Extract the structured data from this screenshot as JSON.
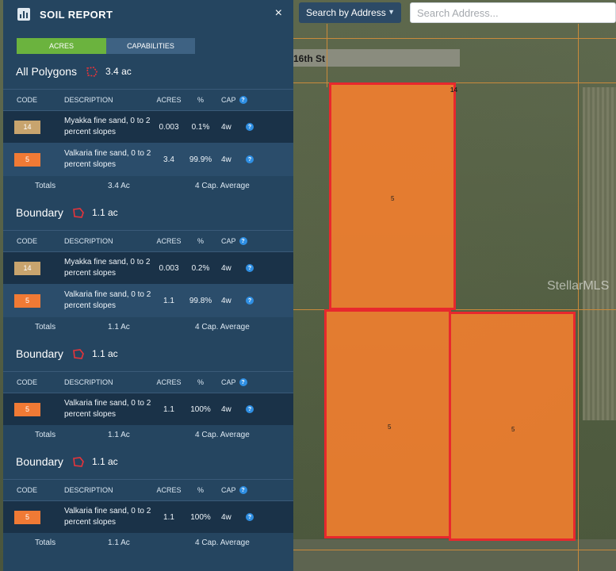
{
  "panel": {
    "title": "SOIL REPORT",
    "close": "×",
    "tabs": [
      "ACRES",
      "CAPABILITIES"
    ],
    "columns": {
      "code": "CODE",
      "description": "DESCRIPTION",
      "acres": "ACRES",
      "pct": "%",
      "cap": "CAP"
    },
    "sections": [
      {
        "title": "All Polygons",
        "area": "3.4 ac",
        "icon": "dashed-polygon-icon",
        "rows": [
          {
            "code": "14",
            "description": "Myakka fine sand, 0 to 2 percent slopes",
            "acres": "0.003",
            "pct": "0.1%",
            "cap": "4w"
          },
          {
            "code": "5",
            "description": "Valkaria fine sand, 0 to 2 percent slopes",
            "acres": "3.4",
            "pct": "99.9%",
            "cap": "4w"
          }
        ],
        "totals": {
          "label": "Totals",
          "acres": "3.4 Ac",
          "cap": "4 Cap. Average"
        }
      },
      {
        "title": "Boundary",
        "area": "1.1 ac",
        "icon": "polygon-icon",
        "rows": [
          {
            "code": "14",
            "description": "Myakka fine sand, 0 to 2 percent slopes",
            "acres": "0.003",
            "pct": "0.2%",
            "cap": "4w"
          },
          {
            "code": "5",
            "description": "Valkaria fine sand, 0 to 2 percent slopes",
            "acres": "1.1",
            "pct": "99.8%",
            "cap": "4w"
          }
        ],
        "totals": {
          "label": "Totals",
          "acres": "1.1 Ac",
          "cap": "4 Cap. Average"
        }
      },
      {
        "title": "Boundary",
        "area": "1.1 ac",
        "icon": "polygon-icon",
        "rows": [
          {
            "code": "5",
            "description": "Valkaria fine sand, 0 to 2 percent slopes",
            "acres": "1.1",
            "pct": "100%",
            "cap": "4w"
          }
        ],
        "totals": {
          "label": "Totals",
          "acres": "1.1 Ac",
          "cap": "4 Cap. Average"
        }
      },
      {
        "title": "Boundary",
        "area": "1.1 ac",
        "icon": "polygon-icon",
        "rows": [
          {
            "code": "5",
            "description": "Valkaria fine sand, 0 to 2 percent slopes",
            "acres": "1.1",
            "pct": "100%",
            "cap": "4w"
          }
        ],
        "totals": {
          "label": "Totals",
          "acres": "1.1 Ac",
          "cap": "4 Cap. Average"
        }
      }
    ]
  },
  "search": {
    "mode": "Search by Address",
    "placeholder": "Search Address..."
  },
  "map": {
    "street": "16th St",
    "corner_label": "14",
    "polygon_labels": [
      "5",
      "5",
      "5"
    ],
    "watermark": "StellarMLS"
  },
  "colors": {
    "code_14": "#c8a46e",
    "code_5": "#f07a35",
    "polygon_fill": "#f7802d",
    "polygon_stroke": "#e8282d",
    "tab_active": "#6bb33e"
  }
}
